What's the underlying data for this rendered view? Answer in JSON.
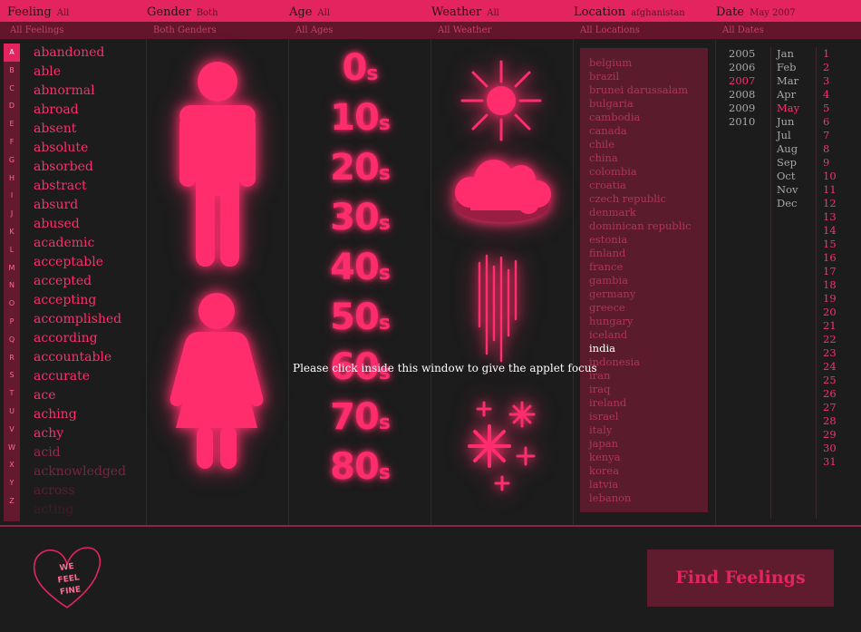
{
  "header": {
    "feeling_label": "Feeling",
    "feeling_value": "All",
    "gender_label": "Gender",
    "gender_value": "Both",
    "age_label": "Age",
    "age_value": "All",
    "weather_label": "Weather",
    "weather_value": "All",
    "location_label": "Location",
    "location_value": "afghanistan",
    "date_label": "Date",
    "date_value": "May 2007"
  },
  "subheader": {
    "feelings": "All Feelings",
    "genders": "Both Genders",
    "ages": "All Ages",
    "weather": "All Weather",
    "locations": "All Locations",
    "dates": "All Dates"
  },
  "alphabet": [
    "A",
    "B",
    "C",
    "D",
    "E",
    "F",
    "G",
    "H",
    "I",
    "J",
    "K",
    "L",
    "M",
    "N",
    "O",
    "P",
    "Q",
    "R",
    "S",
    "T",
    "U",
    "V",
    "W",
    "X",
    "Y",
    "Z"
  ],
  "alphabet_selected": "A",
  "feelings": [
    "abandoned",
    "able",
    "abnormal",
    "abroad",
    "absent",
    "absolute",
    "absorbed",
    "abstract",
    "absurd",
    "abused",
    "academic",
    "acceptable",
    "accepted",
    "accepting",
    "accomplished",
    "according",
    "accountable",
    "accurate",
    "ace",
    "aching",
    "achy",
    "acid",
    "acknowledged",
    "across",
    "acting"
  ],
  "ages": [
    {
      "n": "0",
      "s": "s"
    },
    {
      "n": "10",
      "s": "s"
    },
    {
      "n": "20",
      "s": "s"
    },
    {
      "n": "30",
      "s": "s"
    },
    {
      "n": "40",
      "s": "s"
    },
    {
      "n": "50",
      "s": "s"
    },
    {
      "n": "60",
      "s": "s"
    },
    {
      "n": "70",
      "s": "s"
    },
    {
      "n": "80",
      "s": "s"
    }
  ],
  "weather_icons": [
    "sun-icon",
    "cloud-icon",
    "rain-icon",
    "snow-icon"
  ],
  "gender_icons": [
    "male-icon",
    "female-icon"
  ],
  "locations": [
    "belgium",
    "brazil",
    "brunei darussalam",
    "bulgaria",
    "cambodia",
    "canada",
    "chile",
    "china",
    "colombia",
    "croatia",
    "czech republic",
    "denmark",
    "dominican republic",
    "estonia",
    "finland",
    "france",
    "gambia",
    "germany",
    "greece",
    "hungary",
    "iceland",
    "india",
    "indonesia",
    "iran",
    "iraq",
    "ireland",
    "israel",
    "italy",
    "japan",
    "kenya",
    "korea",
    "latvia",
    "lebanon"
  ],
  "location_selected": "india",
  "years": [
    "2005",
    "2006",
    "2007",
    "2008",
    "2009",
    "2010"
  ],
  "year_selected": "2007",
  "months": [
    "Jan",
    "Feb",
    "Mar",
    "Apr",
    "May",
    "Jun",
    "Jul",
    "Aug",
    "Sep",
    "Oct",
    "Nov",
    "Dec"
  ],
  "month_selected": "May",
  "days": [
    "1",
    "2",
    "3",
    "4",
    "5",
    "6",
    "7",
    "8",
    "9",
    "10",
    "11",
    "12",
    "13",
    "14",
    "15",
    "16",
    "17",
    "18",
    "19",
    "20",
    "21",
    "22",
    "23",
    "24",
    "25",
    "26",
    "27",
    "28",
    "29",
    "30",
    "31"
  ],
  "focus_message": "Please click inside this window to give the applet focus",
  "find_button": "Find Feelings",
  "logo_text": [
    "WE",
    "FEEL",
    "FINE"
  ],
  "colors": {
    "accent": "#e4245e",
    "pink": "#ff2d6c",
    "bg": "#1c1c1c",
    "panel": "#5a1c2d"
  }
}
